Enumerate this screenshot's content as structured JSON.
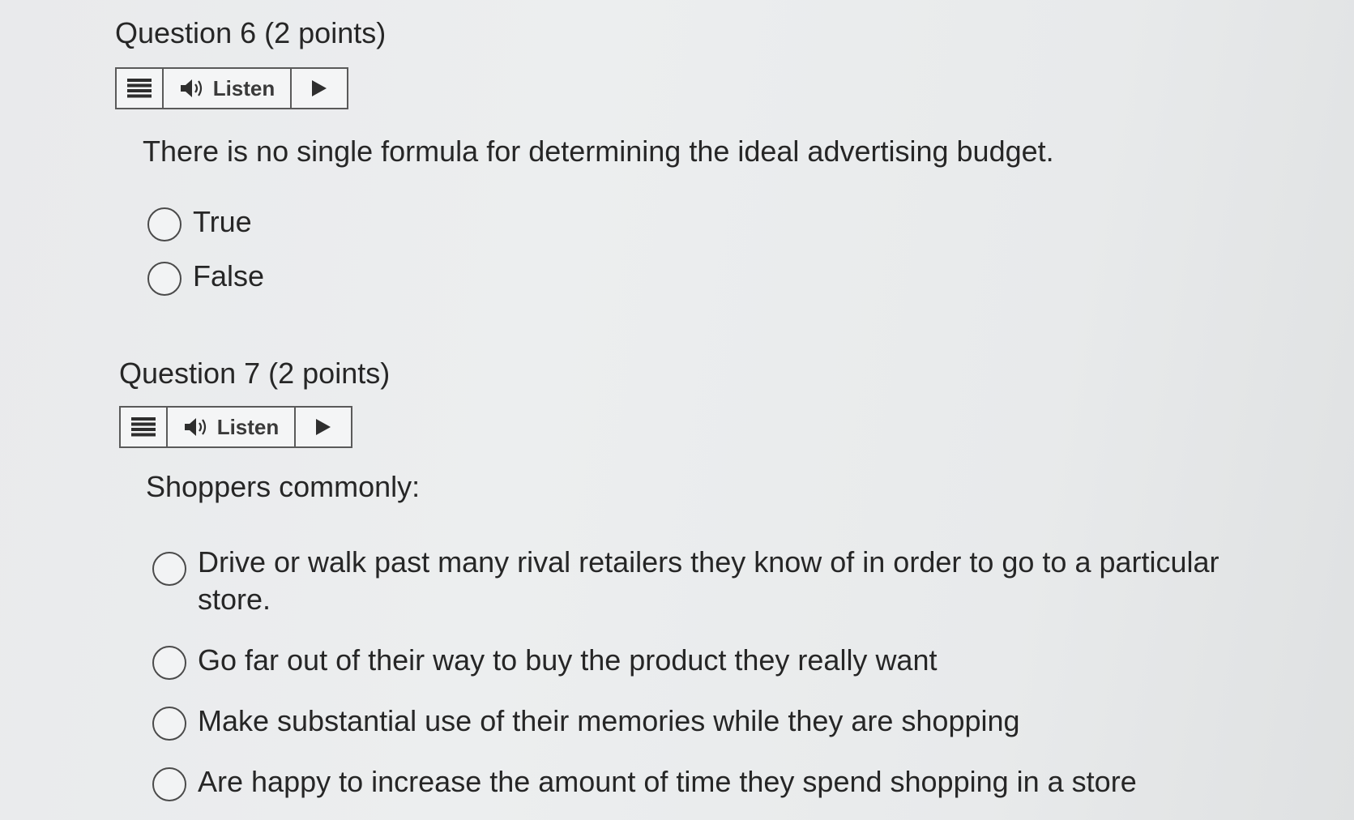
{
  "questions": [
    {
      "title": "Question 6",
      "points": "(2 points)",
      "listen_label": "Listen",
      "stem": "There is no single formula for determining the ideal advertising budget.",
      "options": [
        "True",
        "False"
      ]
    },
    {
      "title": "Question 7",
      "points": "(2 points)",
      "listen_label": "Listen",
      "stem": "Shoppers commonly:",
      "options": [
        "Drive or walk past many rival retailers they know of in order to go to a particular store.",
        "Go far out of their way to buy the product they really want",
        "Make substantial use of their memories while they are shopping",
        "Are happy to increase the amount of time they spend shopping in a store"
      ]
    }
  ],
  "icons": {
    "menu": "hamburger-menu-icon",
    "speaker": "speaker-icon",
    "play": "play-icon"
  },
  "colors": {
    "text": "#262626",
    "border": "#5a5a5a",
    "background": "#eceeef"
  }
}
